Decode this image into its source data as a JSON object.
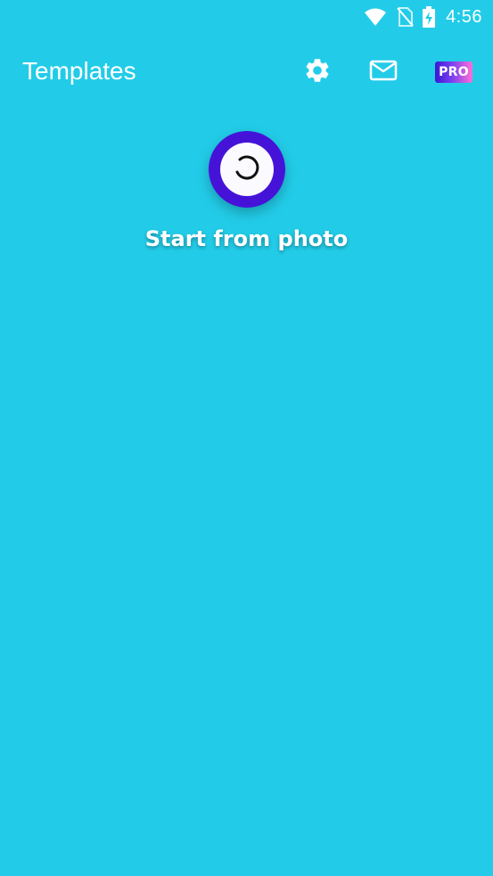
{
  "status_bar": {
    "time": "4:56",
    "icons": [
      "wifi-icon",
      "no-sim-icon",
      "battery-charging-icon"
    ]
  },
  "app_bar": {
    "title": "Templates",
    "actions": [
      {
        "name": "settings",
        "icon": "gear-icon"
      },
      {
        "name": "mail",
        "icon": "mail-icon"
      },
      {
        "name": "pro",
        "label": "PRO"
      }
    ]
  },
  "main": {
    "start_label": "Start from photo",
    "start_icon": "loading-spinner-icon"
  },
  "colors": {
    "background": "#22cce8",
    "accent": "#4513d8",
    "pro_gradient": [
      "#3a17d6",
      "#7a3ff0",
      "#ff6fd8"
    ]
  }
}
